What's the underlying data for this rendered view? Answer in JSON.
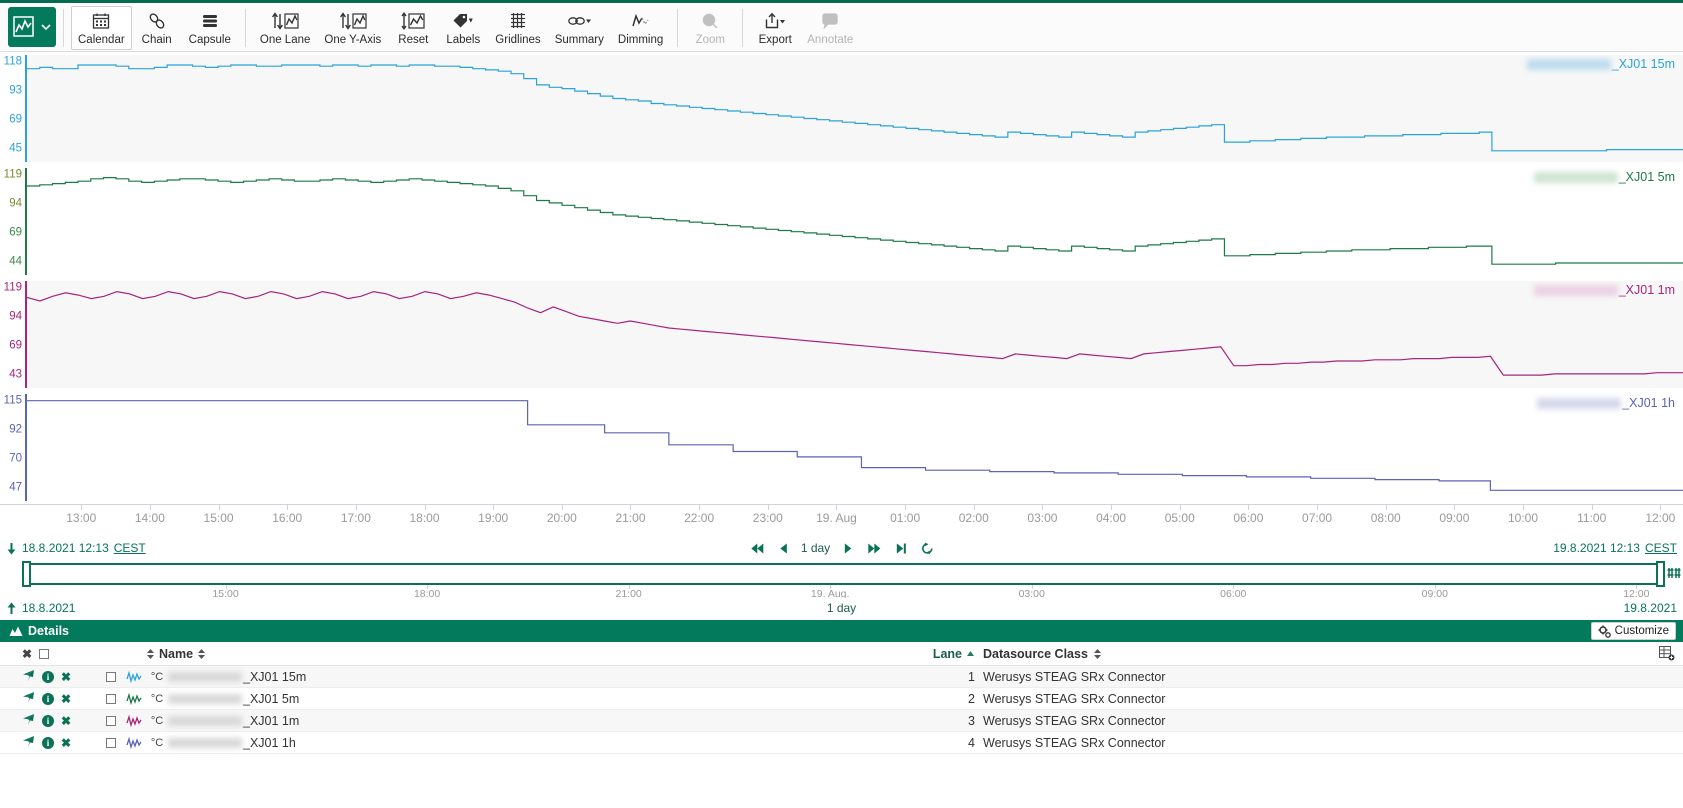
{
  "toolbar": {
    "logo_name": "chart-logo",
    "buttons": [
      {
        "label": "Calendar",
        "icon": "calendar-icon",
        "state": "active"
      },
      {
        "label": "Chain",
        "icon": "chain-icon",
        "state": "normal"
      },
      {
        "label": "Capsule",
        "icon": "capsule-icon",
        "state": "normal"
      },
      {
        "label": "One Lane",
        "icon": "one-lane-icon",
        "state": "normal"
      },
      {
        "label": "One Y-Axis",
        "icon": "one-y-axis-icon",
        "state": "normal"
      },
      {
        "label": "Reset",
        "icon": "reset-icon",
        "state": "normal"
      },
      {
        "label": "Labels",
        "icon": "labels-icon",
        "state": "normal"
      },
      {
        "label": "Gridlines",
        "icon": "gridlines-icon",
        "state": "normal"
      },
      {
        "label": "Summary",
        "icon": "summary-icon",
        "state": "normal"
      },
      {
        "label": "Dimming",
        "icon": "dimming-icon",
        "state": "normal"
      },
      {
        "label": "Zoom",
        "icon": "zoom-icon",
        "state": "disabled"
      },
      {
        "label": "Export",
        "icon": "export-icon",
        "state": "normal"
      },
      {
        "label": "Annotate",
        "icon": "annotate-icon",
        "state": "disabled"
      }
    ]
  },
  "chart_data": {
    "type": "line",
    "title": "",
    "xlabel": "",
    "ylabel": "",
    "x_tick_labels": [
      "13:00",
      "14:00",
      "15:00",
      "16:00",
      "17:00",
      "18:00",
      "19:00",
      "20:00",
      "21:00",
      "22:00",
      "23:00",
      "19. Aug",
      "01:00",
      "02:00",
      "03:00",
      "04:00",
      "05:00",
      "06:00",
      "07:00",
      "08:00",
      "09:00",
      "10:00",
      "11:00",
      "12:00"
    ],
    "x_range": [
      "18.8.2021 12:13 CEST",
      "19.8.2021 12:13 CEST"
    ],
    "grid": false,
    "legend_position": "top-right-per-lane",
    "lanes": [
      {
        "lane": 1,
        "label_suffix": "_XJ01 15m",
        "color": "#2aa3d8",
        "y_ticks": [
          118,
          93,
          69,
          45
        ],
        "ylim": [
          38,
          124
        ],
        "unit": "°C",
        "values": [
          113,
          114,
          113,
          113,
          116,
          116,
          116,
          115,
          113,
          113,
          114,
          116,
          116,
          115,
          114,
          115,
          116,
          116,
          115,
          115,
          116,
          116,
          116,
          115,
          116,
          116,
          115,
          116,
          116,
          115,
          116,
          116,
          115,
          115,
          114,
          113,
          112,
          111,
          109,
          105,
          100,
          98,
          97,
          95,
          93,
          91,
          89,
          88,
          87,
          85,
          84,
          83,
          82,
          81,
          80,
          79,
          78,
          77,
          76,
          75,
          74,
          73,
          72,
          71,
          70,
          69,
          68,
          67,
          66,
          65,
          64,
          63,
          62,
          61,
          60,
          59,
          58,
          62,
          61,
          60,
          59,
          58,
          62,
          61,
          60,
          59,
          58,
          62,
          63,
          64,
          65,
          66,
          67,
          68,
          54,
          54,
          55,
          55,
          56,
          56,
          57,
          57,
          58,
          58,
          58,
          59,
          59,
          59,
          60,
          60,
          60,
          61,
          61,
          61,
          62,
          47,
          47,
          47,
          47,
          47,
          47,
          47,
          47,
          47,
          48,
          48,
          48,
          48,
          48,
          48,
          48
        ]
      },
      {
        "lane": 2,
        "label_suffix": "_XJ01 5m",
        "color": "#1d7a48",
        "y_ticks": [
          119,
          94,
          69,
          44
        ],
        "ylim": [
          36,
          125
        ],
        "unit": "°C",
        "values": [
          110,
          111,
          112,
          113,
          114,
          116,
          117,
          116,
          114,
          113,
          114,
          115,
          116,
          116,
          115,
          114,
          113,
          114,
          115,
          116,
          115,
          114,
          114,
          115,
          116,
          115,
          114,
          113,
          114,
          115,
          116,
          115,
          114,
          113,
          112,
          111,
          110,
          108,
          106,
          102,
          98,
          96,
          94,
          92,
          90,
          88,
          86,
          85,
          84,
          83,
          82,
          81,
          80,
          79,
          78,
          77,
          76,
          75,
          74,
          73,
          72,
          71,
          70,
          69,
          68,
          67,
          66,
          65,
          64,
          63,
          62,
          61,
          60,
          59,
          58,
          57,
          56,
          60,
          59,
          58,
          57,
          56,
          60,
          59,
          58,
          57,
          56,
          60,
          61,
          62,
          63,
          64,
          65,
          66,
          52,
          52,
          53,
          53,
          54,
          54,
          55,
          55,
          56,
          56,
          57,
          57,
          57,
          58,
          58,
          58,
          59,
          59,
          59,
          60,
          60,
          45,
          45,
          45,
          45,
          45,
          46,
          46,
          46,
          46,
          46,
          46,
          46,
          46,
          46,
          46,
          46
        ]
      },
      {
        "lane": 3,
        "label_suffix": "_XJ01 1m",
        "color": "#a8247e",
        "y_ticks": [
          119,
          94,
          69,
          43
        ],
        "ylim": [
          35,
          126
        ],
        "unit": "°C",
        "values": [
          112,
          109,
          113,
          116,
          114,
          111,
          113,
          117,
          115,
          111,
          113,
          117,
          115,
          111,
          113,
          117,
          115,
          111,
          113,
          117,
          115,
          111,
          113,
          117,
          115,
          111,
          113,
          117,
          115,
          111,
          113,
          117,
          115,
          111,
          113,
          116,
          114,
          111,
          108,
          103,
          99,
          104,
          100,
          96,
          94,
          92,
          90,
          92,
          90,
          88,
          86,
          85,
          84,
          83,
          82,
          81,
          80,
          79,
          78,
          77,
          76,
          75,
          74,
          73,
          72,
          71,
          70,
          69,
          68,
          67,
          66,
          65,
          64,
          63,
          62,
          61,
          60,
          64,
          63,
          62,
          61,
          60,
          64,
          63,
          62,
          61,
          60,
          64,
          65,
          66,
          67,
          68,
          69,
          70,
          54,
          54,
          55,
          55,
          56,
          56,
          57,
          57,
          58,
          58,
          58,
          59,
          59,
          59,
          60,
          60,
          60,
          61,
          61,
          61,
          62,
          46,
          46,
          46,
          46,
          47,
          47,
          47,
          47,
          47,
          47,
          47,
          47,
          48,
          48,
          48
        ]
      },
      {
        "lane": 4,
        "label_suffix": "_XJ01 1h",
        "color": "#5b63b5",
        "y_ticks": [
          115,
          92,
          70,
          47
        ],
        "ylim": [
          40,
          120
        ],
        "unit": "°C",
        "values": [
          115,
          115,
          115,
          115,
          115,
          115,
          115,
          115,
          115,
          115,
          115,
          115,
          115,
          115,
          115,
          115,
          115,
          115,
          115,
          115,
          115,
          115,
          115,
          115,
          115,
          115,
          115,
          115,
          115,
          115,
          115,
          115,
          115,
          115,
          115,
          115,
          115,
          115,
          115,
          97,
          97,
          97,
          97,
          97,
          97,
          91,
          91,
          91,
          91,
          91,
          82,
          82,
          82,
          82,
          82,
          77,
          77,
          77,
          77,
          77,
          73,
          73,
          73,
          73,
          73,
          65,
          65,
          65,
          65,
          65,
          63,
          63,
          63,
          63,
          63,
          62,
          62,
          62,
          62,
          62,
          61,
          61,
          61,
          61,
          61,
          60,
          60,
          60,
          60,
          60,
          59,
          59,
          59,
          59,
          59,
          58,
          58,
          58,
          58,
          58,
          57,
          57,
          57,
          57,
          57,
          56,
          56,
          56,
          56,
          56,
          55,
          55,
          55,
          55,
          48,
          48,
          48,
          48,
          48,
          48,
          48,
          48,
          48,
          48,
          48,
          48,
          48,
          48,
          48,
          48
        ]
      }
    ]
  },
  "nav": {
    "start_time": "18.8.2021 12:13",
    "start_tz": "CEST",
    "end_time": "19.8.2021 12:13",
    "end_tz": "CEST",
    "range_label": "1 day",
    "controls": [
      "skip-back-icon",
      "step-back-icon",
      "play-icon",
      "step-forward-icon",
      "skip-forward-icon",
      "refresh-icon"
    ]
  },
  "overview": {
    "tick_labels": [
      "15:00",
      "18:00",
      "21:00",
      "19. Aug.",
      "03:00",
      "06:00",
      "09:00",
      "12:00"
    ],
    "left_date": "18.8.2021",
    "center_label": "1 day",
    "right_date": "19.8.2021"
  },
  "details": {
    "title": "Details",
    "customize_label": "Customize",
    "columns": {
      "name": "Name",
      "lane": "Lane",
      "datasource_class": "Datasource Class"
    },
    "rows": [
      {
        "unit": "°C",
        "name_suffix": "_XJ01 15m",
        "lane": "1",
        "datasource_class": "Werusys STEAG SRx Connector",
        "color": "#2aa3d8"
      },
      {
        "unit": "°C",
        "name_suffix": "_XJ01 5m",
        "lane": "2",
        "datasource_class": "Werusys STEAG SRx Connector",
        "color": "#1d7a48"
      },
      {
        "unit": "°C",
        "name_suffix": "_XJ01 1m",
        "lane": "3",
        "datasource_class": "Werusys STEAG SRx Connector",
        "color": "#a8247e"
      },
      {
        "unit": "°C",
        "name_suffix": "_XJ01 1h",
        "lane": "4",
        "datasource_class": "Werusys STEAG SRx Connector",
        "color": "#5b63b5"
      }
    ]
  },
  "colors": {
    "brand_green": "#047a5c",
    "accent_dark": "#0b7258",
    "lane1": "#2aa3d8",
    "lane2": "#1d7a48",
    "lane3": "#a8247e",
    "lane4": "#5b63b5"
  }
}
